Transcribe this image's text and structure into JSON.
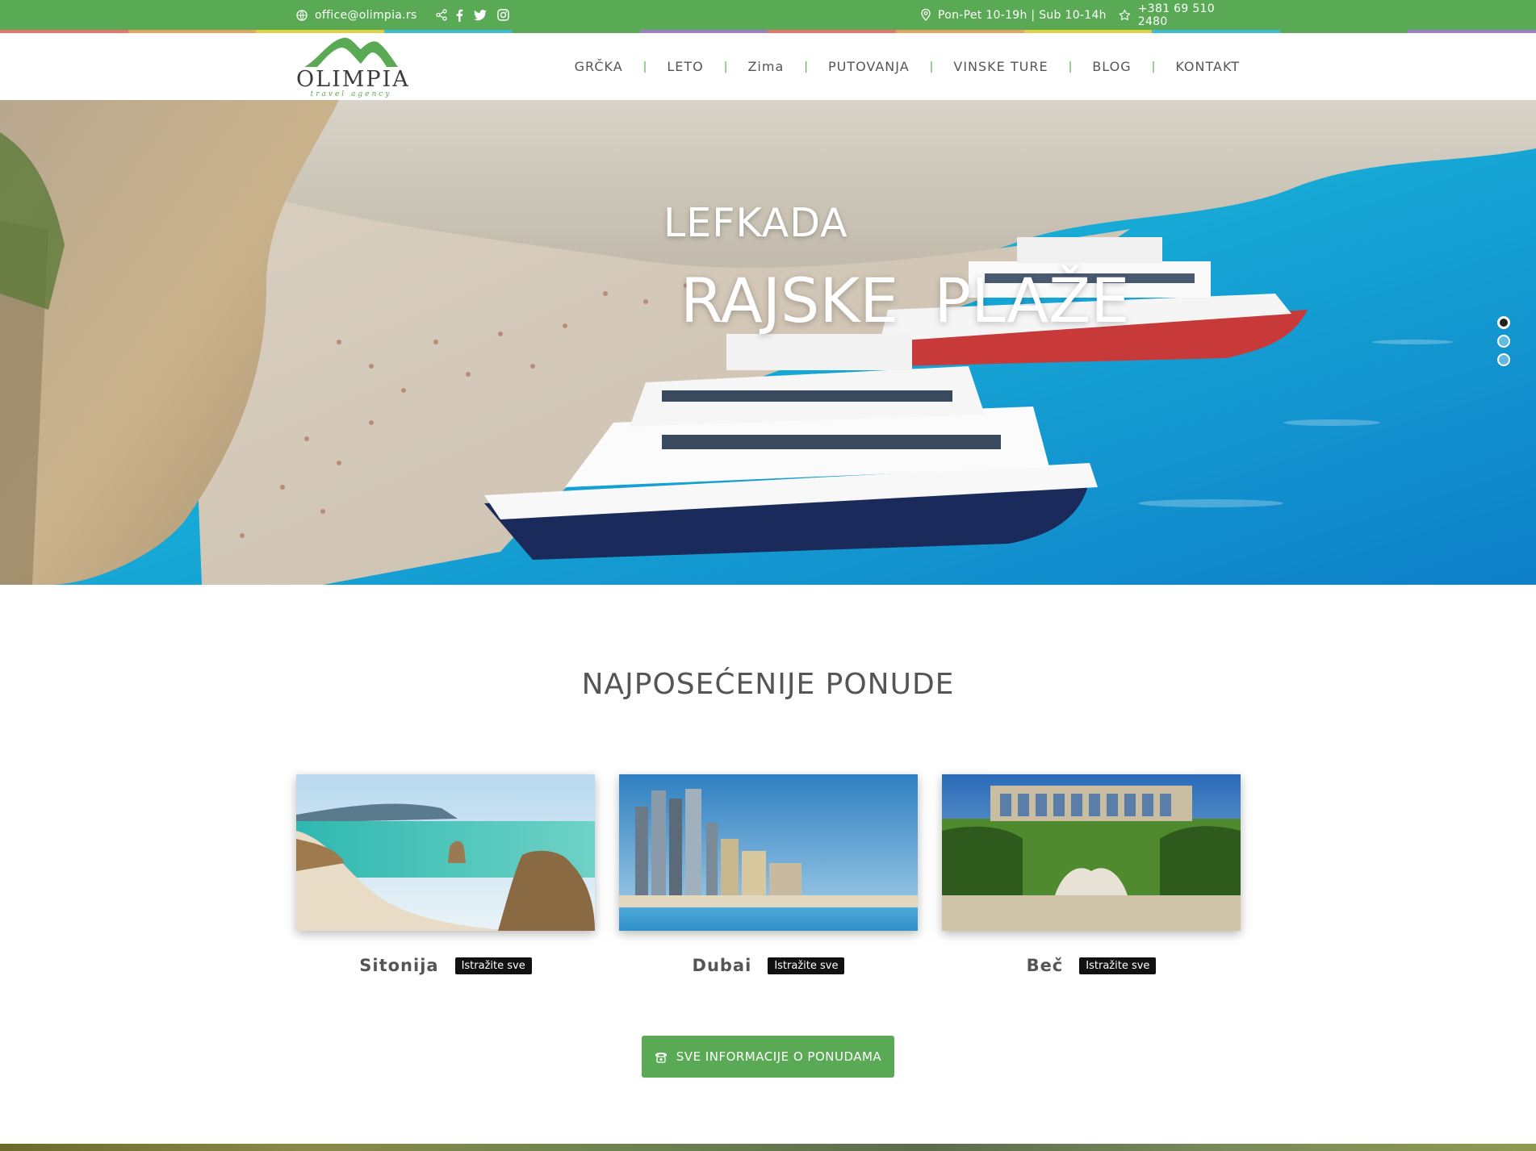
{
  "topbar": {
    "email": "office@olimpia.rs",
    "hours": "Pon-Pet 10-19h | Sub 10-14h",
    "phone": "+381 69 510 2480",
    "icons": [
      "globe-icon",
      "share-icon",
      "facebook-icon",
      "twitter-icon",
      "instagram-icon",
      "map-pin-icon",
      "star-icon"
    ]
  },
  "brand": {
    "name": "OLIMPIA",
    "tagline": "travel agency",
    "accent_color": "#5aaa55"
  },
  "nav": {
    "items": [
      "GRČKA",
      "LETO",
      "Zima",
      "PUTOVANJA",
      "VINSKE TURE",
      "BLOG",
      "KONTAKT"
    ],
    "separator": "|"
  },
  "hero": {
    "title": "LEFKADA",
    "subtitle": "RAJSKE PLAŽE",
    "slide_count": 3,
    "active_slide": 1
  },
  "offers": {
    "heading": "NAJPOSEĆENIJE PONUDE",
    "cards": [
      {
        "title": "Sitonija",
        "button": "Istražite sve"
      },
      {
        "title": "Dubai",
        "button": "Istražite sve"
      },
      {
        "title": "Beč",
        "button": "Istražite sve"
      }
    ],
    "cta_label": "SVE INFORMACIJE O PONUDAMA"
  }
}
